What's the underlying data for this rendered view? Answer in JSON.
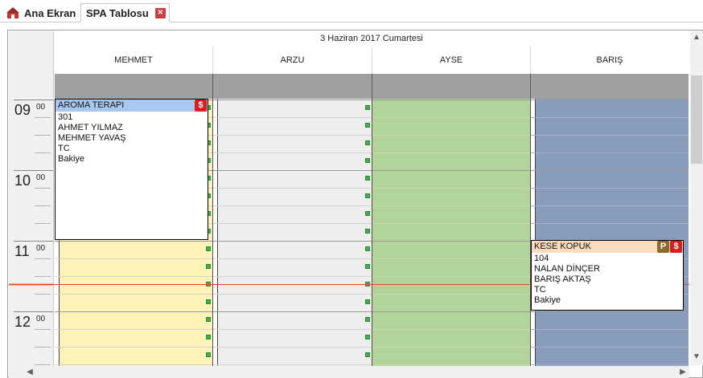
{
  "tabs": [
    {
      "label": "Ana Ekran"
    },
    {
      "label": "SPA Tablosu"
    }
  ],
  "scheduler": {
    "date": "3 Haziran 2017 Cumartesi",
    "staff": [
      "MEHMET",
      "ARZU",
      "AYSE",
      "BARIŞ"
    ],
    "hours": [
      {
        "hour": "09",
        "min": "00"
      },
      {
        "hour": "10",
        "min": "00"
      },
      {
        "hour": "11",
        "min": "00"
      },
      {
        "hour": "12",
        "min": "00"
      }
    ],
    "column_colors": [
      "#fdf2b8",
      "#eeeeee",
      "#b3d498",
      "#8a9cbc"
    ],
    "unavailable_color": "#eeeeee",
    "appointments": [
      {
        "title": "AROMA TERAPI",
        "title_color": "#a8c8f0",
        "badges": [
          "$"
        ],
        "lines": [
          "301",
          "AHMET YILMAZ",
          "MEHMET YAVAŞ",
          "TC",
          "Bakiye"
        ]
      },
      {
        "title": "KESE KOPUK",
        "title_color": "#f9dcc0",
        "badges": [
          "P",
          "$"
        ],
        "lines": [
          "104",
          "NALAN DİNÇER",
          "BARIŞ AKTAŞ",
          "TC",
          "Bakiye"
        ]
      }
    ]
  },
  "scroll": {
    "up": "▲",
    "down": "▼",
    "left": "◀",
    "right": "▶"
  }
}
